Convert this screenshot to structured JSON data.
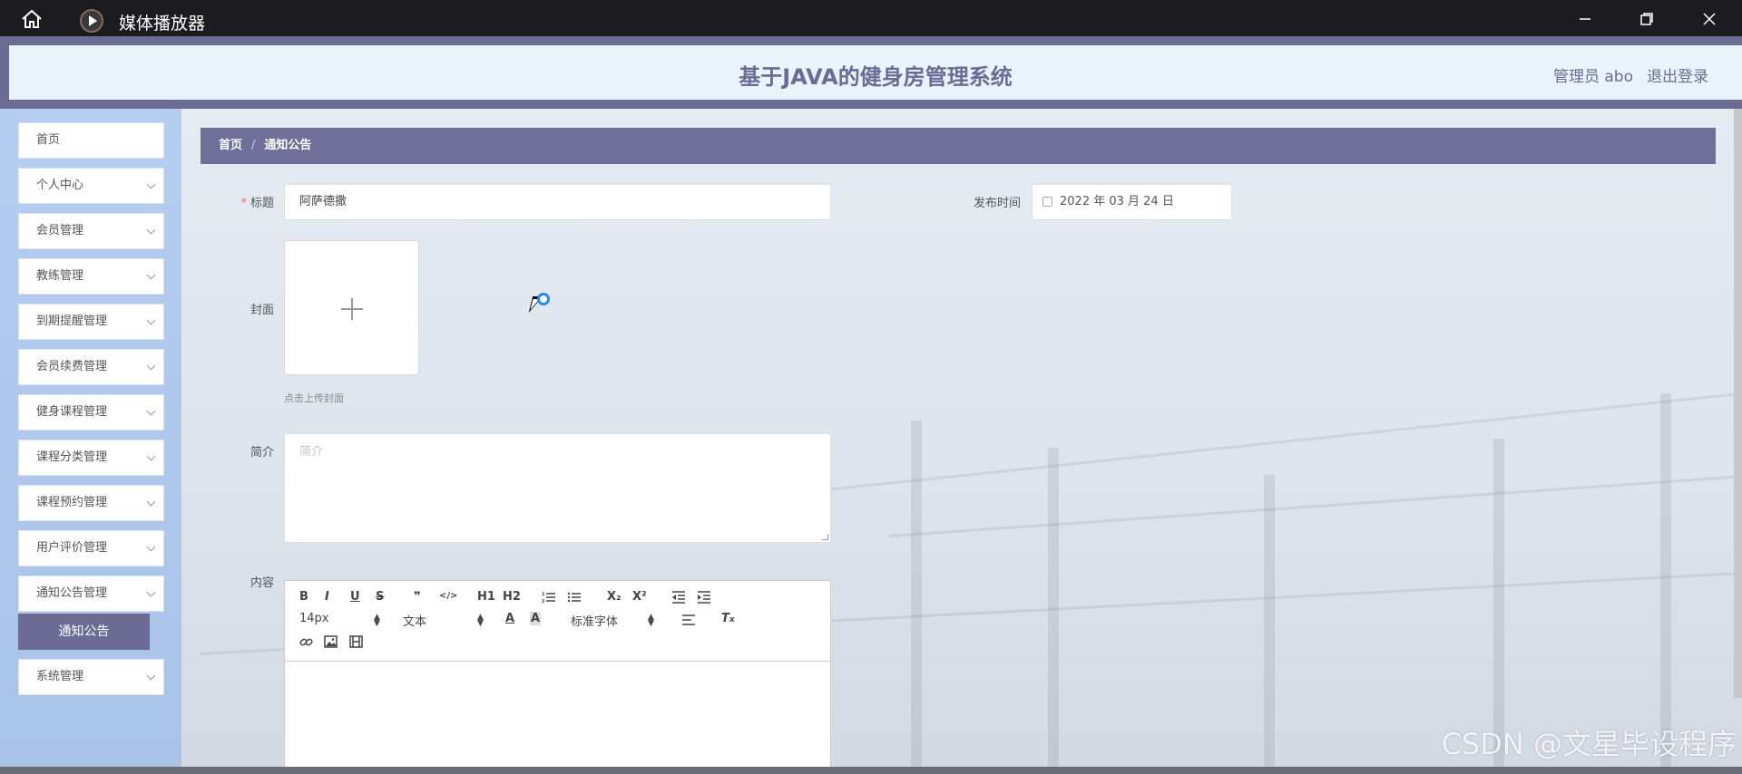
{
  "window": {
    "title": "媒体播放器",
    "icons": [
      "home-icon",
      "media-player-icon",
      "minimize-icon",
      "restore-icon",
      "close-icon"
    ]
  },
  "header": {
    "system_title": "基于JAVA的健身房管理系统",
    "admin_label": "管理员 abo",
    "logout_label": "退出登录"
  },
  "sidebar": {
    "items": [
      {
        "label": "首页",
        "has_children": false
      },
      {
        "label": "个人中心",
        "has_children": true
      },
      {
        "label": "会员管理",
        "has_children": true
      },
      {
        "label": "教练管理",
        "has_children": true
      },
      {
        "label": "到期提醒管理",
        "has_children": true
      },
      {
        "label": "会员续费管理",
        "has_children": true
      },
      {
        "label": "健身课程管理",
        "has_children": true
      },
      {
        "label": "课程分类管理",
        "has_children": true
      },
      {
        "label": "课程预约管理",
        "has_children": true
      },
      {
        "label": "用户评价管理",
        "has_children": true
      },
      {
        "label": "通知公告管理",
        "has_children": true
      },
      {
        "label": "系统管理",
        "has_children": true
      }
    ],
    "active_sub": "通知公告"
  },
  "breadcrumb": {
    "home": "首页",
    "separator": "/",
    "current": "通知公告"
  },
  "form": {
    "title_label": "标题",
    "required_mark": "*",
    "title_value": "阿萨德撒",
    "publish_label": "发布时间",
    "publish_value": "2022 年 03 月 24 日",
    "cover_label": "封面",
    "cover_hint": "点击上传封面",
    "intro_label": "简介",
    "intro_placeholder": "简介",
    "content_label": "内容"
  },
  "editor": {
    "font_size": "14px",
    "text_style": "文本",
    "font_family": "标准字体",
    "buttons": [
      "B",
      "I",
      "U",
      "S",
      "❞",
      "</>",
      "H1",
      "H2",
      "ordered-list",
      "bullet-list",
      "X₂",
      "X²",
      "outdent",
      "indent",
      "font-color",
      "background-color",
      "align",
      "clear-format",
      "link",
      "image",
      "video"
    ]
  },
  "watermark": "CSDN @文星毕设程序",
  "colors": {
    "primary": "#6b6b94",
    "header_bg": "#e8f3fc",
    "sidebar_bg": "#b5cdef",
    "required": "#f56c6c"
  }
}
